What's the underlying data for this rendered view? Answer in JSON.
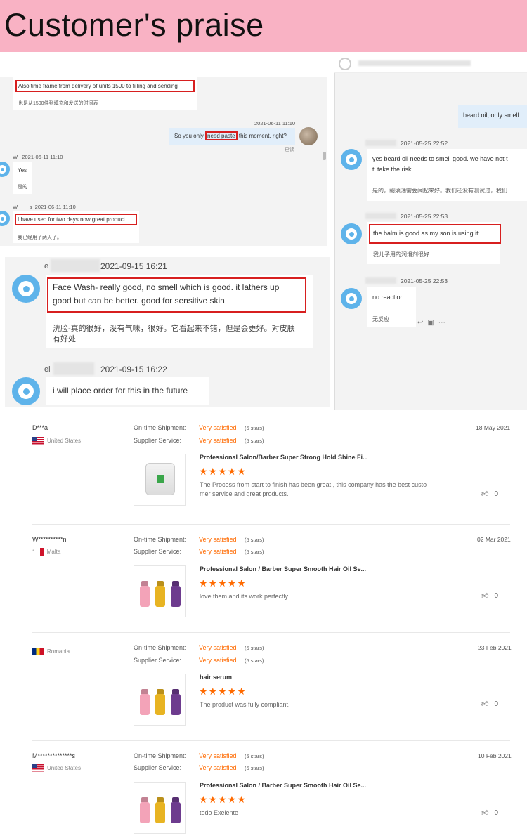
{
  "banner": {
    "title": "Customer's praise"
  },
  "chat1": {
    "msg1_en": "Also time frame from delivery of units 1500 to filling and sending",
    "msg1_cn": "也是从1500件到填充和发送的时间表",
    "ts1": "2021-06-11 11:10",
    "msg2_pre": "So you only ",
    "msg2_hl": "need paste",
    "msg2_post": " this moment, right?",
    "read": "已读",
    "ts2": "W   2021-06-11 11:10",
    "msg3_en": "Yes",
    "msg3_cn": "是的",
    "ts3": "W        s  2021-06-11 11:10",
    "msg4_en": "I have used for two days now great product.",
    "msg4_cn": "我已经用了两天了。"
  },
  "chat2": {
    "msg1_en": "beard oil, only smell",
    "ts1": "2021-05-25 22:52",
    "msg2_en": "yes beard oil needs to smell good. we have not t ti take the risk.",
    "msg2_line1": "yes beard oil needs to smell good. we have not t",
    "msg2_line2": "ti take the risk.",
    "msg2_cn": "是的，胡须油需要闻起来好。我们还没有测试过，我们",
    "ts2": "2021-05-25 22:53",
    "msg3_en": "the balm is good as my son is using it",
    "msg3_cn": "我儿子用的润滑剂很好",
    "ts3": "2021-05-25 22:53",
    "msg4_en": "no reaction",
    "msg4_cn": "无反应"
  },
  "chat3": {
    "ts1_prefix": "e",
    "ts1": "2021-09-15 16:21",
    "msg1_line1": "Face Wash- really good, no smell which is good. it lathers up",
    "msg1_line2": "good but can be better. good for sensitive skin",
    "msg1_cn_line1": "洗脸-真的很好，没有气味，很好。它看起来不错，但是会更好。对皮肤",
    "msg1_cn_line2": "有好处",
    "ts2_prefix": "ei",
    "ts2": "2021-09-15 16:22",
    "msg2": "i will place order for this in the future"
  },
  "labels": {
    "shipment": "On-time Shipment:",
    "service": "Supplier Service:",
    "satisfied": "Very satisfied",
    "stars": "(5 stars)"
  },
  "reviews": [
    {
      "name": "D***a",
      "country": "United States",
      "date": "18 May 2021",
      "product": "Professional Salon/Barber Super Strong Hold Shine Fi...",
      "text1": "The Process from start to finish has been great , this company has the best custo",
      "text2": "mer service and great products.",
      "likes": "0"
    },
    {
      "name": "W**********n",
      "country": "Malta",
      "date": "02 Mar 2021",
      "product": "Professional Salon / Barber Super Smooth Hair Oil Se...",
      "text1": "love them and its work perfectly",
      "text2": "",
      "likes": "0"
    },
    {
      "name": "",
      "country": "Romania",
      "date": "23 Feb 2021",
      "product": "hair serum",
      "text1": "The product was fully compliant.",
      "text2": "",
      "likes": "0"
    },
    {
      "name": "M**************s",
      "country": "United States",
      "date": "10 Feb 2021",
      "product": "Professional Salon / Barber Super Smooth Hair Oil Se...",
      "text1": "todo Exelente",
      "text2": "",
      "likes": "0"
    }
  ],
  "icons": {
    "stars": "★★★★★",
    "like": "like-icon",
    "avatar": "avatar-icon"
  }
}
